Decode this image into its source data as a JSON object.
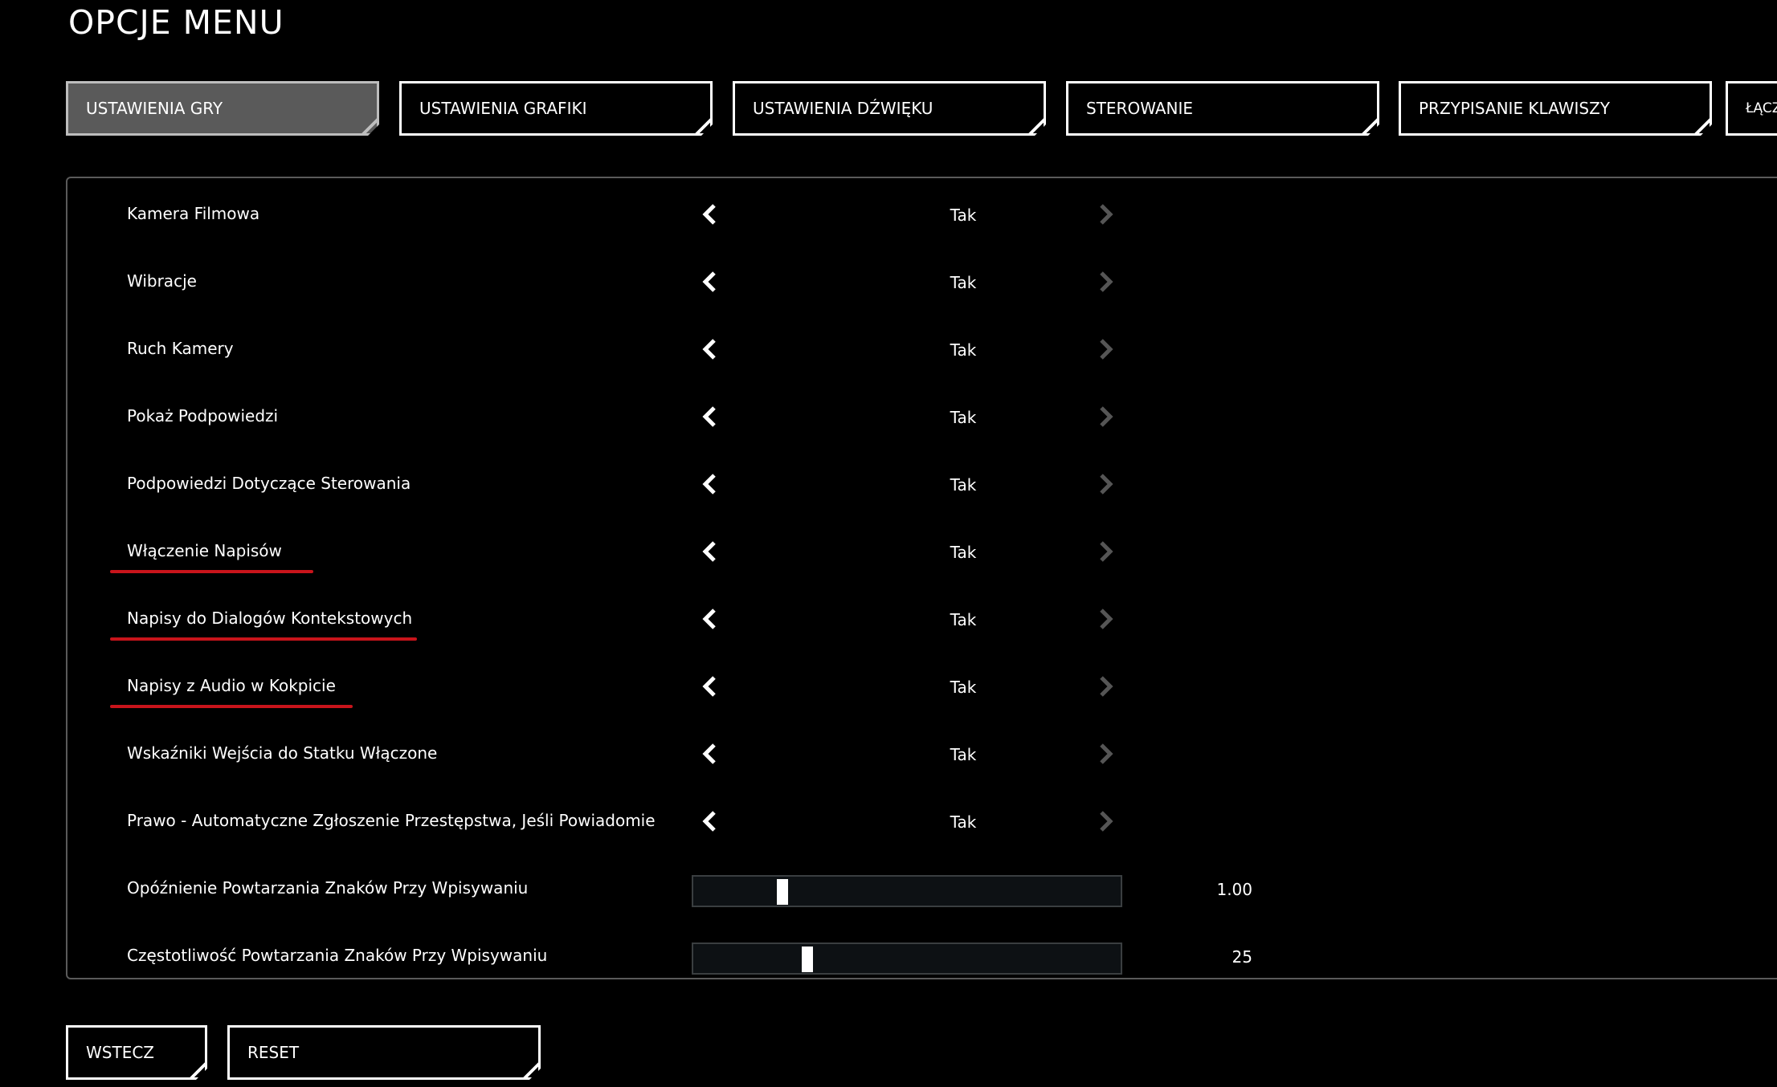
{
  "header": {
    "title": "OPCJE MENU"
  },
  "tabs": [
    {
      "label": "USTAWIENIA GRY",
      "active": true
    },
    {
      "label": "USTAWIENIA GRAFIKI",
      "active": false
    },
    {
      "label": "USTAWIENIA DŹWIĘKU",
      "active": false
    },
    {
      "label": "STEROWANIE",
      "active": false
    },
    {
      "label": "PRZYPISANIE KLAWISZY",
      "active": false
    },
    {
      "label": "ŁĄCZ",
      "active": false
    }
  ],
  "settings": [
    {
      "label": "Kamera Filmowa",
      "value": "Tak",
      "underlined": false
    },
    {
      "label": "Wibracje",
      "value": "Tak",
      "underlined": false
    },
    {
      "label": "Ruch Kamery",
      "value": "Tak",
      "underlined": false
    },
    {
      "label": "Pokaż Podpowiedzi",
      "value": "Tak",
      "underlined": false
    },
    {
      "label": "Podpowiedzi Dotyczące Sterowania",
      "value": "Tak",
      "underlined": false
    },
    {
      "label": "Włączenie Napisów",
      "value": "Tak",
      "underlined": true
    },
    {
      "label": "Napisy do Dialogów Kontekstowych",
      "value": "Tak",
      "underlined": true
    },
    {
      "label": "Napisy z Audio w Kokpicie",
      "value": "Tak",
      "underlined": true
    },
    {
      "label": "Wskaźniki Wejścia do Statku Włączone",
      "value": "Tak",
      "underlined": false
    },
    {
      "label": "Prawo - Automatyczne Zgłoszenie Przestępstwa, Jeśli Powiadomie",
      "value": "Tak",
      "underlined": false
    }
  ],
  "sliders": [
    {
      "label": "Opóźnienie Powtarzania Znaków Przy Wpisywaniu",
      "value": "1.00",
      "fraction": 0.2
    },
    {
      "label": "Częstotliwość Powtarzania Znaków Przy Wpisywaniu",
      "value": "25",
      "fraction": 0.26
    }
  ],
  "footer": {
    "back_label": "WSTECZ",
    "reset_label": "RESET"
  },
  "icons": {
    "arrow_left": "chevron-left-icon",
    "arrow_right": "chevron-right-icon"
  },
  "colors": {
    "background": "#000000",
    "active_tab": "#5a5a5a",
    "underline": "#c8141b",
    "arrow_left": "#ffffff",
    "arrow_right_disabled": "#555555",
    "slider_track": "#0d1114"
  }
}
